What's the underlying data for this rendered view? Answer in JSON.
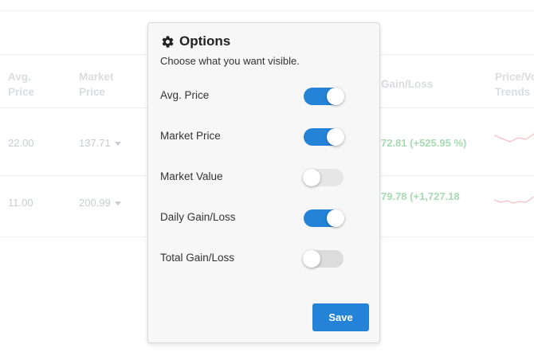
{
  "table": {
    "headers": [
      {
        "key": "avg_price",
        "label": "Avg.\nPrice"
      },
      {
        "key": "market_price",
        "label": "Market\nPrice"
      },
      {
        "key": "total_gain",
        "label": "Gain/Loss"
      },
      {
        "key": "price_trends",
        "label": "Price/Vo\nTrends"
      }
    ],
    "rows": [
      {
        "avg_price": "22.00",
        "market_price": "137.71",
        "gain": "72.81 (+525.95 %)"
      },
      {
        "avg_price": "11.00",
        "market_price": "200.99",
        "gain": "79.78 (+1,727.18"
      }
    ]
  },
  "modal": {
    "icon": "gear-icon",
    "title": "Options",
    "subtitle": "Choose what you want visible.",
    "options": [
      {
        "label": "Avg. Price",
        "enabled": true
      },
      {
        "label": "Market Price",
        "enabled": true
      },
      {
        "label": "Market Value",
        "enabled": false
      },
      {
        "label": "Daily Gain/Loss",
        "enabled": true
      },
      {
        "label": "Total Gain/Loss",
        "enabled": false
      }
    ],
    "save_label": "Save"
  },
  "colors": {
    "accent": "#2483d6",
    "toggle_off": "#dcdcdc",
    "gain_green": "#a6dbb0"
  }
}
